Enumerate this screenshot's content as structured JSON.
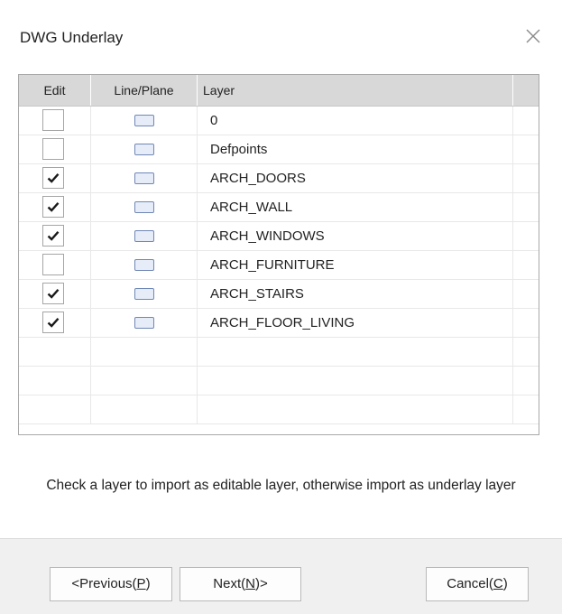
{
  "dialog": {
    "title": "DWG Underlay",
    "close_icon": "close-icon"
  },
  "grid": {
    "columns": {
      "edit": "Edit",
      "line_plane": "Line/Plane",
      "layer": "Layer"
    },
    "rows": [
      {
        "name": "0",
        "edit": false
      },
      {
        "name": "Defpoints",
        "edit": false
      },
      {
        "name": "ARCH_DOORS",
        "edit": true
      },
      {
        "name": "ARCH_WALL",
        "edit": true
      },
      {
        "name": "ARCH_WINDOWS",
        "edit": true
      },
      {
        "name": "ARCH_FURNITURE",
        "edit": false
      },
      {
        "name": "ARCH_STAIRS",
        "edit": true
      },
      {
        "name": "ARCH_FLOOR_LIVING",
        "edit": true
      }
    ],
    "empty_rows": 3,
    "icons": {
      "checkmark": "checkmark-icon",
      "plane": "plane-icon"
    }
  },
  "hint": {
    "text": "Check a layer to import as editable layer, otherwise import as underlay layer"
  },
  "buttons": {
    "previous": "<Previous(P)",
    "previous_mnemonic": "P",
    "next": "Next(N)>",
    "next_mnemonic": "N",
    "cancel": "Cancel(C)",
    "cancel_mnemonic": "C"
  }
}
